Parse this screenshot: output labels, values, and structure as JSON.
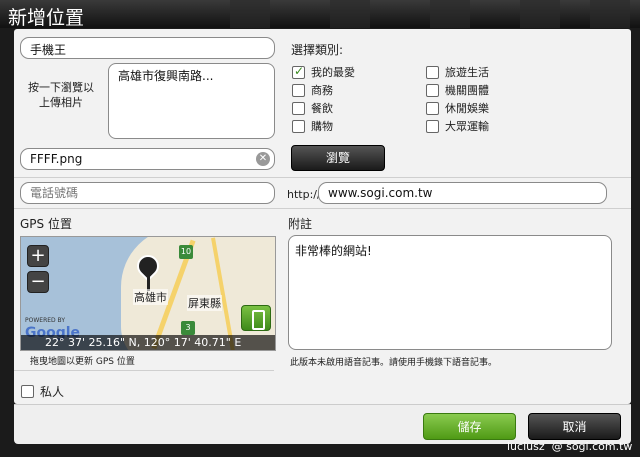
{
  "window": {
    "title": "新增位置"
  },
  "form": {
    "name_value": "手機王",
    "photo_hint": "按一下瀏覽以\n上傳相片",
    "address_value": "高雄市復興南路...",
    "file_value": "FFFF.png",
    "browse_label": "瀏覽",
    "phone_placeholder": "電話號碼",
    "url_prefix": "http://",
    "url_value": "www.sogi.com.tw"
  },
  "category": {
    "heading": "選擇類別:",
    "items": [
      {
        "label": "我的最愛",
        "checked": true
      },
      {
        "label": "商務",
        "checked": false
      },
      {
        "label": "餐飲",
        "checked": false
      },
      {
        "label": "購物",
        "checked": false
      },
      {
        "label": "旅遊生活",
        "checked": false
      },
      {
        "label": "機關團體",
        "checked": false
      },
      {
        "label": "休閒娛樂",
        "checked": false
      },
      {
        "label": "大眾運輸",
        "checked": false
      }
    ]
  },
  "gps": {
    "heading": "GPS 位置",
    "zoom_in": "+",
    "zoom_out": "−",
    "coords": "22° 37' 25.16\" N, 120° 17' 40.71\" E",
    "place_city": "高雄市",
    "place_county": "屏東縣",
    "shield_a": "10",
    "shield_b": "3",
    "powered_by": "POWERED BY",
    "google": "Google",
    "hint": "拖曳地圖以更新 GPS 位置"
  },
  "note": {
    "heading": "附註",
    "value": "非常棒的網站!",
    "hint": "此版本未啟用語音記事。請使用手機錄下語音記事。"
  },
  "private_label": "私人",
  "buttons": {
    "save": "儲存",
    "cancel": "取消"
  },
  "watermark": "luciusz  @ sogi.com.tw",
  "colors": {
    "save_green": "#5aa61d",
    "check_green": "#3a8a1f"
  }
}
